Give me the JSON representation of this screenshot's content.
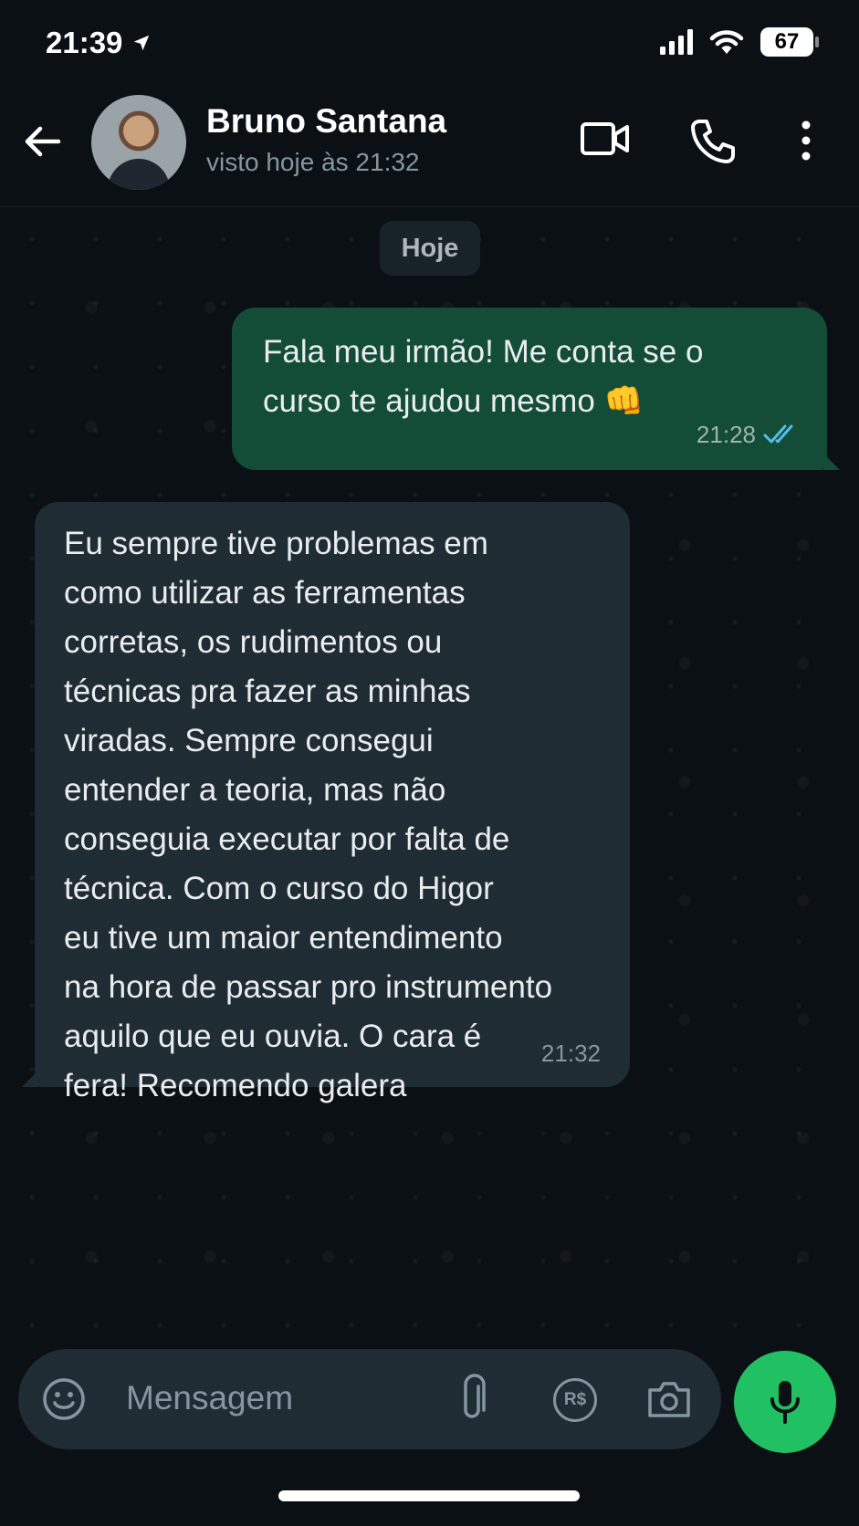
{
  "status_bar": {
    "time": "21:39",
    "battery": "67",
    "icons": [
      "location-arrow-icon",
      "signal-icon",
      "wifi-icon",
      "battery-icon"
    ]
  },
  "header": {
    "contact_name": "Bruno Santana",
    "contact_status": "visto hoje às 21:32",
    "icons": [
      "back-arrow-icon",
      "video-call-icon",
      "voice-call-icon",
      "more-options-icon"
    ]
  },
  "chat": {
    "date_chip": "Hoje",
    "messages": [
      {
        "direction": "outgoing",
        "text": "Fala meu irmão! Me conta se o\ncurso te ajudou mesmo 👊",
        "time": "21:28",
        "status": "read"
      },
      {
        "direction": "incoming",
        "text": "Eu sempre tive problemas em\ncomo utilizar as ferramentas\ncorretas, os rudimentos ou\ntécnicas pra fazer as minhas\nviradas. Sempre consegui\nentender a teoria, mas não\nconseguia executar por falta de\ntécnica. Com o curso do Higor\neu tive um maior entendimento\nna hora de passar pro instrumento\naquilo que eu ouvia. O cara é\nfera! Recomendo galera",
        "time": "21:32"
      }
    ]
  },
  "composer": {
    "placeholder": "Mensagem",
    "icons": [
      "emoji-icon",
      "attach-icon",
      "payment-icon",
      "camera-icon",
      "mic-icon"
    ],
    "payment_label": "R$"
  },
  "colors": {
    "background": "#0b1014",
    "outgoing_bubble": "#144d37",
    "incoming_bubble": "#202c33",
    "accent": "#21c063",
    "read_ticks": "#53bdeb"
  }
}
